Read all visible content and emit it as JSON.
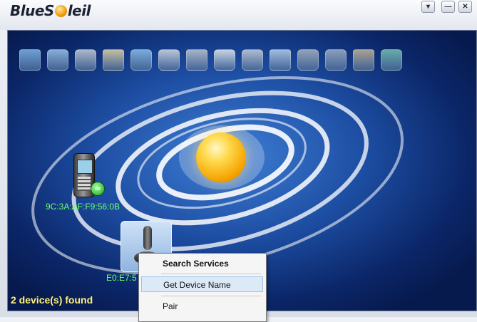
{
  "app": {
    "logo_text_1": "BlueS",
    "logo_text_2": "leil"
  },
  "window_controls": {
    "menu": "▾",
    "minimize": "—",
    "close": "✕"
  },
  "toolbar": {
    "icons": [
      "network-access-icon",
      "lan-access-icon",
      "printer-icon",
      "file-transfer-icon",
      "sync-icon",
      "business-card-icon",
      "fax-icon",
      "mouse-icon",
      "dialup-icon",
      "image-transfer-icon",
      "headset-icon",
      "hearing-aid-icon",
      "serial-port-icon",
      "global-icon"
    ]
  },
  "devices": [
    {
      "label": "9C:3A:AF:F9:56:0B",
      "type": "mobile-phone",
      "connected": true
    },
    {
      "label": "E0:E7:5",
      "type": "joystick",
      "selected": true
    }
  ],
  "status": {
    "found_text": "2 device(s) found"
  },
  "context_menu": {
    "items": [
      {
        "label": "Search Services",
        "bold": true
      },
      {
        "label": "Get Device Name",
        "highlighted": true
      },
      {
        "label": "Pair"
      }
    ]
  },
  "colors": {
    "stage_center": "#3f7fd6",
    "stage_edge": "#071a4e",
    "device_label": "#6dff6d",
    "status_text": "#fff27a"
  }
}
